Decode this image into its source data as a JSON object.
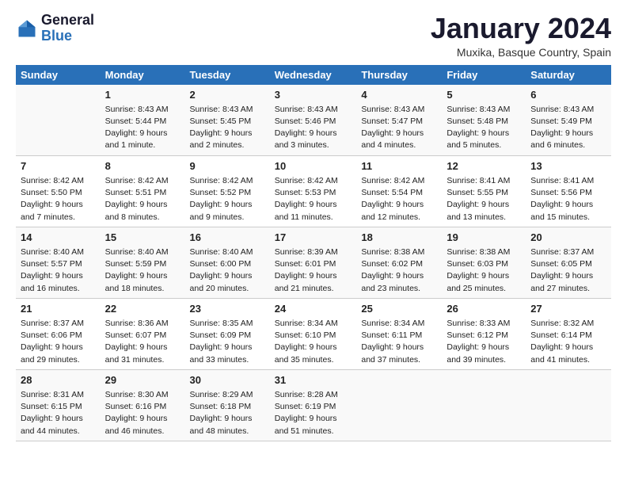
{
  "logo": {
    "line1": "General",
    "line2": "Blue"
  },
  "title": "January 2024",
  "subtitle": "Muxika, Basque Country, Spain",
  "headers": [
    "Sunday",
    "Monday",
    "Tuesday",
    "Wednesday",
    "Thursday",
    "Friday",
    "Saturday"
  ],
  "weeks": [
    [
      {
        "day": "",
        "sunrise": "",
        "sunset": "",
        "daylight": ""
      },
      {
        "day": "1",
        "sunrise": "Sunrise: 8:43 AM",
        "sunset": "Sunset: 5:44 PM",
        "daylight": "Daylight: 9 hours and 1 minute."
      },
      {
        "day": "2",
        "sunrise": "Sunrise: 8:43 AM",
        "sunset": "Sunset: 5:45 PM",
        "daylight": "Daylight: 9 hours and 2 minutes."
      },
      {
        "day": "3",
        "sunrise": "Sunrise: 8:43 AM",
        "sunset": "Sunset: 5:46 PM",
        "daylight": "Daylight: 9 hours and 3 minutes."
      },
      {
        "day": "4",
        "sunrise": "Sunrise: 8:43 AM",
        "sunset": "Sunset: 5:47 PM",
        "daylight": "Daylight: 9 hours and 4 minutes."
      },
      {
        "day": "5",
        "sunrise": "Sunrise: 8:43 AM",
        "sunset": "Sunset: 5:48 PM",
        "daylight": "Daylight: 9 hours and 5 minutes."
      },
      {
        "day": "6",
        "sunrise": "Sunrise: 8:43 AM",
        "sunset": "Sunset: 5:49 PM",
        "daylight": "Daylight: 9 hours and 6 minutes."
      }
    ],
    [
      {
        "day": "7",
        "sunrise": "Sunrise: 8:42 AM",
        "sunset": "Sunset: 5:50 PM",
        "daylight": "Daylight: 9 hours and 7 minutes."
      },
      {
        "day": "8",
        "sunrise": "Sunrise: 8:42 AM",
        "sunset": "Sunset: 5:51 PM",
        "daylight": "Daylight: 9 hours and 8 minutes."
      },
      {
        "day": "9",
        "sunrise": "Sunrise: 8:42 AM",
        "sunset": "Sunset: 5:52 PM",
        "daylight": "Daylight: 9 hours and 9 minutes."
      },
      {
        "day": "10",
        "sunrise": "Sunrise: 8:42 AM",
        "sunset": "Sunset: 5:53 PM",
        "daylight": "Daylight: 9 hours and 11 minutes."
      },
      {
        "day": "11",
        "sunrise": "Sunrise: 8:42 AM",
        "sunset": "Sunset: 5:54 PM",
        "daylight": "Daylight: 9 hours and 12 minutes."
      },
      {
        "day": "12",
        "sunrise": "Sunrise: 8:41 AM",
        "sunset": "Sunset: 5:55 PM",
        "daylight": "Daylight: 9 hours and 13 minutes."
      },
      {
        "day": "13",
        "sunrise": "Sunrise: 8:41 AM",
        "sunset": "Sunset: 5:56 PM",
        "daylight": "Daylight: 9 hours and 15 minutes."
      }
    ],
    [
      {
        "day": "14",
        "sunrise": "Sunrise: 8:40 AM",
        "sunset": "Sunset: 5:57 PM",
        "daylight": "Daylight: 9 hours and 16 minutes."
      },
      {
        "day": "15",
        "sunrise": "Sunrise: 8:40 AM",
        "sunset": "Sunset: 5:59 PM",
        "daylight": "Daylight: 9 hours and 18 minutes."
      },
      {
        "day": "16",
        "sunrise": "Sunrise: 8:40 AM",
        "sunset": "Sunset: 6:00 PM",
        "daylight": "Daylight: 9 hours and 20 minutes."
      },
      {
        "day": "17",
        "sunrise": "Sunrise: 8:39 AM",
        "sunset": "Sunset: 6:01 PM",
        "daylight": "Daylight: 9 hours and 21 minutes."
      },
      {
        "day": "18",
        "sunrise": "Sunrise: 8:38 AM",
        "sunset": "Sunset: 6:02 PM",
        "daylight": "Daylight: 9 hours and 23 minutes."
      },
      {
        "day": "19",
        "sunrise": "Sunrise: 8:38 AM",
        "sunset": "Sunset: 6:03 PM",
        "daylight": "Daylight: 9 hours and 25 minutes."
      },
      {
        "day": "20",
        "sunrise": "Sunrise: 8:37 AM",
        "sunset": "Sunset: 6:05 PM",
        "daylight": "Daylight: 9 hours and 27 minutes."
      }
    ],
    [
      {
        "day": "21",
        "sunrise": "Sunrise: 8:37 AM",
        "sunset": "Sunset: 6:06 PM",
        "daylight": "Daylight: 9 hours and 29 minutes."
      },
      {
        "day": "22",
        "sunrise": "Sunrise: 8:36 AM",
        "sunset": "Sunset: 6:07 PM",
        "daylight": "Daylight: 9 hours and 31 minutes."
      },
      {
        "day": "23",
        "sunrise": "Sunrise: 8:35 AM",
        "sunset": "Sunset: 6:09 PM",
        "daylight": "Daylight: 9 hours and 33 minutes."
      },
      {
        "day": "24",
        "sunrise": "Sunrise: 8:34 AM",
        "sunset": "Sunset: 6:10 PM",
        "daylight": "Daylight: 9 hours and 35 minutes."
      },
      {
        "day": "25",
        "sunrise": "Sunrise: 8:34 AM",
        "sunset": "Sunset: 6:11 PM",
        "daylight": "Daylight: 9 hours and 37 minutes."
      },
      {
        "day": "26",
        "sunrise": "Sunrise: 8:33 AM",
        "sunset": "Sunset: 6:12 PM",
        "daylight": "Daylight: 9 hours and 39 minutes."
      },
      {
        "day": "27",
        "sunrise": "Sunrise: 8:32 AM",
        "sunset": "Sunset: 6:14 PM",
        "daylight": "Daylight: 9 hours and 41 minutes."
      }
    ],
    [
      {
        "day": "28",
        "sunrise": "Sunrise: 8:31 AM",
        "sunset": "Sunset: 6:15 PM",
        "daylight": "Daylight: 9 hours and 44 minutes."
      },
      {
        "day": "29",
        "sunrise": "Sunrise: 8:30 AM",
        "sunset": "Sunset: 6:16 PM",
        "daylight": "Daylight: 9 hours and 46 minutes."
      },
      {
        "day": "30",
        "sunrise": "Sunrise: 8:29 AM",
        "sunset": "Sunset: 6:18 PM",
        "daylight": "Daylight: 9 hours and 48 minutes."
      },
      {
        "day": "31",
        "sunrise": "Sunrise: 8:28 AM",
        "sunset": "Sunset: 6:19 PM",
        "daylight": "Daylight: 9 hours and 51 minutes."
      },
      {
        "day": "",
        "sunrise": "",
        "sunset": "",
        "daylight": ""
      },
      {
        "day": "",
        "sunrise": "",
        "sunset": "",
        "daylight": ""
      },
      {
        "day": "",
        "sunrise": "",
        "sunset": "",
        "daylight": ""
      }
    ]
  ]
}
